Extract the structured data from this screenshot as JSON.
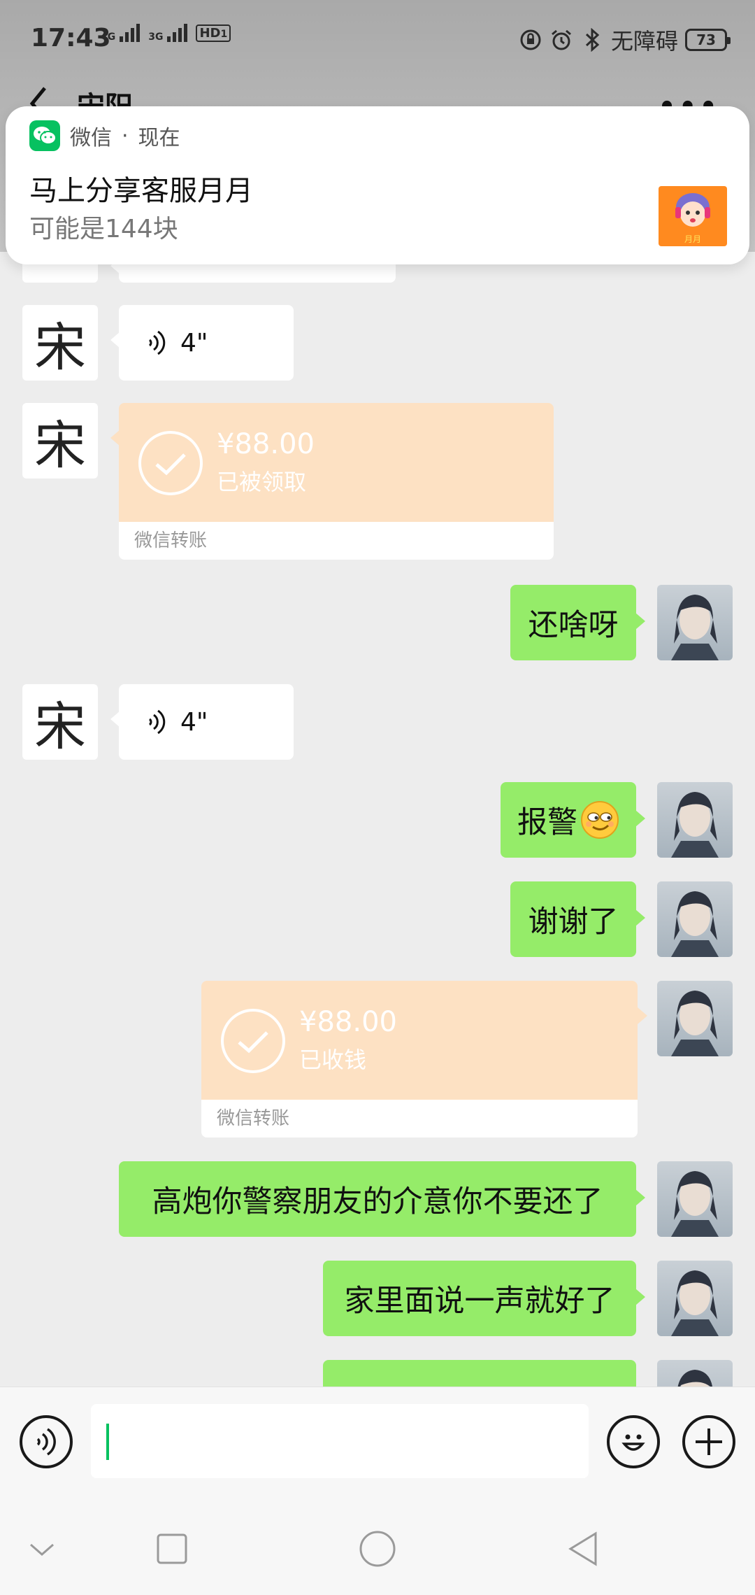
{
  "status_bar": {
    "time": "17:43",
    "network_1": "4G",
    "network_2": "3G",
    "hd": "HD",
    "hd_sub": "1",
    "accessibility": "无障碍",
    "battery": "73"
  },
  "header": {
    "title": "宋阳"
  },
  "notification": {
    "app_name": "微信",
    "separator": "·",
    "time": "现在",
    "title": "马上分享客服月月",
    "body": "可能是144块",
    "thumb_label": "月月"
  },
  "contact_avatar_char": "宋",
  "messages": {
    "voice_1": {
      "duration": "4\""
    },
    "transfer_1": {
      "amount": "¥88.00",
      "status": "已被领取",
      "footer": "微信转账"
    },
    "text_1": "还啥呀",
    "voice_2": {
      "duration": "4\""
    },
    "text_2": "报警",
    "text_3": "谢谢了",
    "transfer_2": {
      "amount": "¥88.00",
      "status": "已收钱",
      "footer": "微信转账"
    },
    "text_4": "高炮你警察朋友的介意你不要还了",
    "text_5": "家里面说一声就好了"
  },
  "input_bar": {
    "value": ""
  },
  "colors": {
    "bubble_out": "#95ec69",
    "bubble_in": "#ffffff",
    "transfer": "#fde1c3",
    "wechat_green": "#07c160",
    "background": "#ededed"
  },
  "icons": {
    "back": "chevron-left-icon",
    "more": "more-icon",
    "voice": "voice-icon",
    "emoji": "emoji-icon",
    "plus": "plus-icon"
  }
}
